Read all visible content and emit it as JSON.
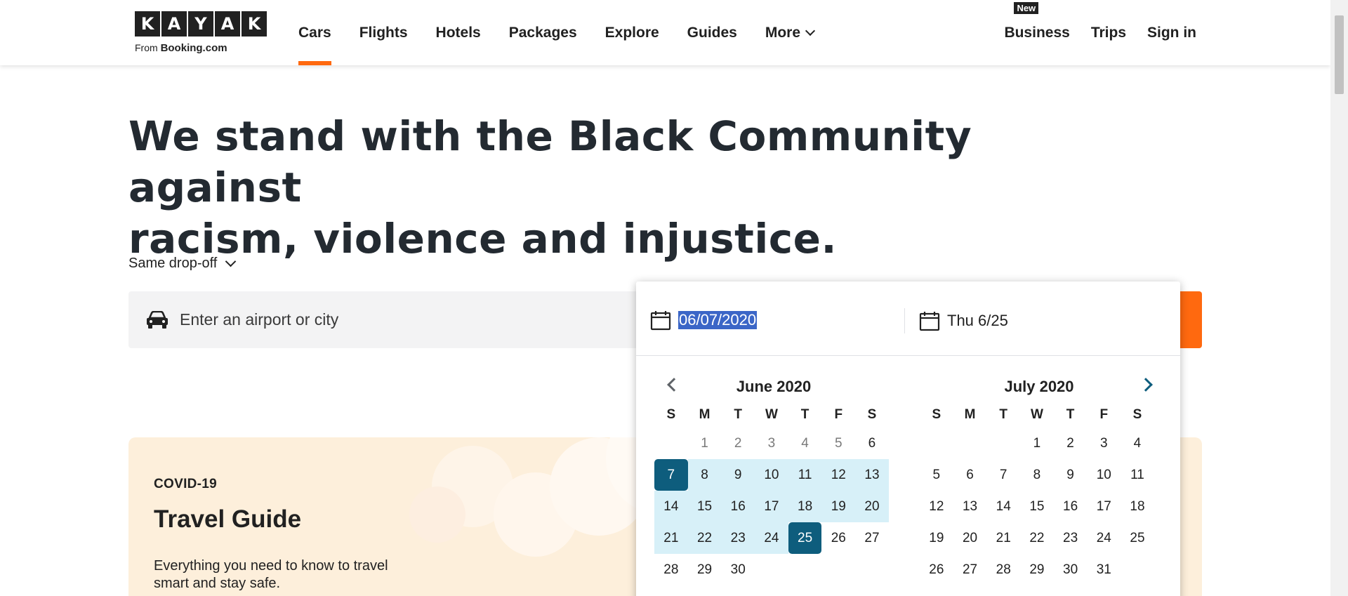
{
  "header": {
    "logo_letters": [
      "K",
      "A",
      "Y",
      "A",
      "K"
    ],
    "logo_from": "From",
    "logo_brand": "Booking.com",
    "nav": [
      {
        "label": "Cars",
        "active": true
      },
      {
        "label": "Flights"
      },
      {
        "label": "Hotels"
      },
      {
        "label": "Packages"
      },
      {
        "label": "Explore"
      },
      {
        "label": "Guides"
      }
    ],
    "more_label": "More",
    "business_label": "Business",
    "new_badge": "New",
    "trips_label": "Trips",
    "signin_label": "Sign in"
  },
  "hero": {
    "title_line1": "We stand with the Black Community against",
    "title_line2": "racism, violence and injustice."
  },
  "search": {
    "dropoff_label": "Same drop-off",
    "location_placeholder": "Enter an airport or city",
    "start_date": "06/07/2020",
    "end_date": "Thu 6/25"
  },
  "calendar": {
    "weekdays": [
      "S",
      "M",
      "T",
      "W",
      "T",
      "F",
      "S"
    ],
    "months": [
      {
        "title": "June 2020",
        "first_weekday": 1,
        "days": 30,
        "past_until": 5,
        "range_start": 7,
        "range_end": 25
      },
      {
        "title": "July 2020",
        "first_weekday": 3,
        "days": 31
      }
    ]
  },
  "covid": {
    "label": "COVID-19",
    "title": "Travel Guide",
    "text": "Everything you need to know to travel smart and stay safe."
  },
  "colors": {
    "accent": "#ff690f",
    "selected": "#0e5d7d",
    "range": "#d7f0f8",
    "card_bg": "#fdefdb"
  }
}
